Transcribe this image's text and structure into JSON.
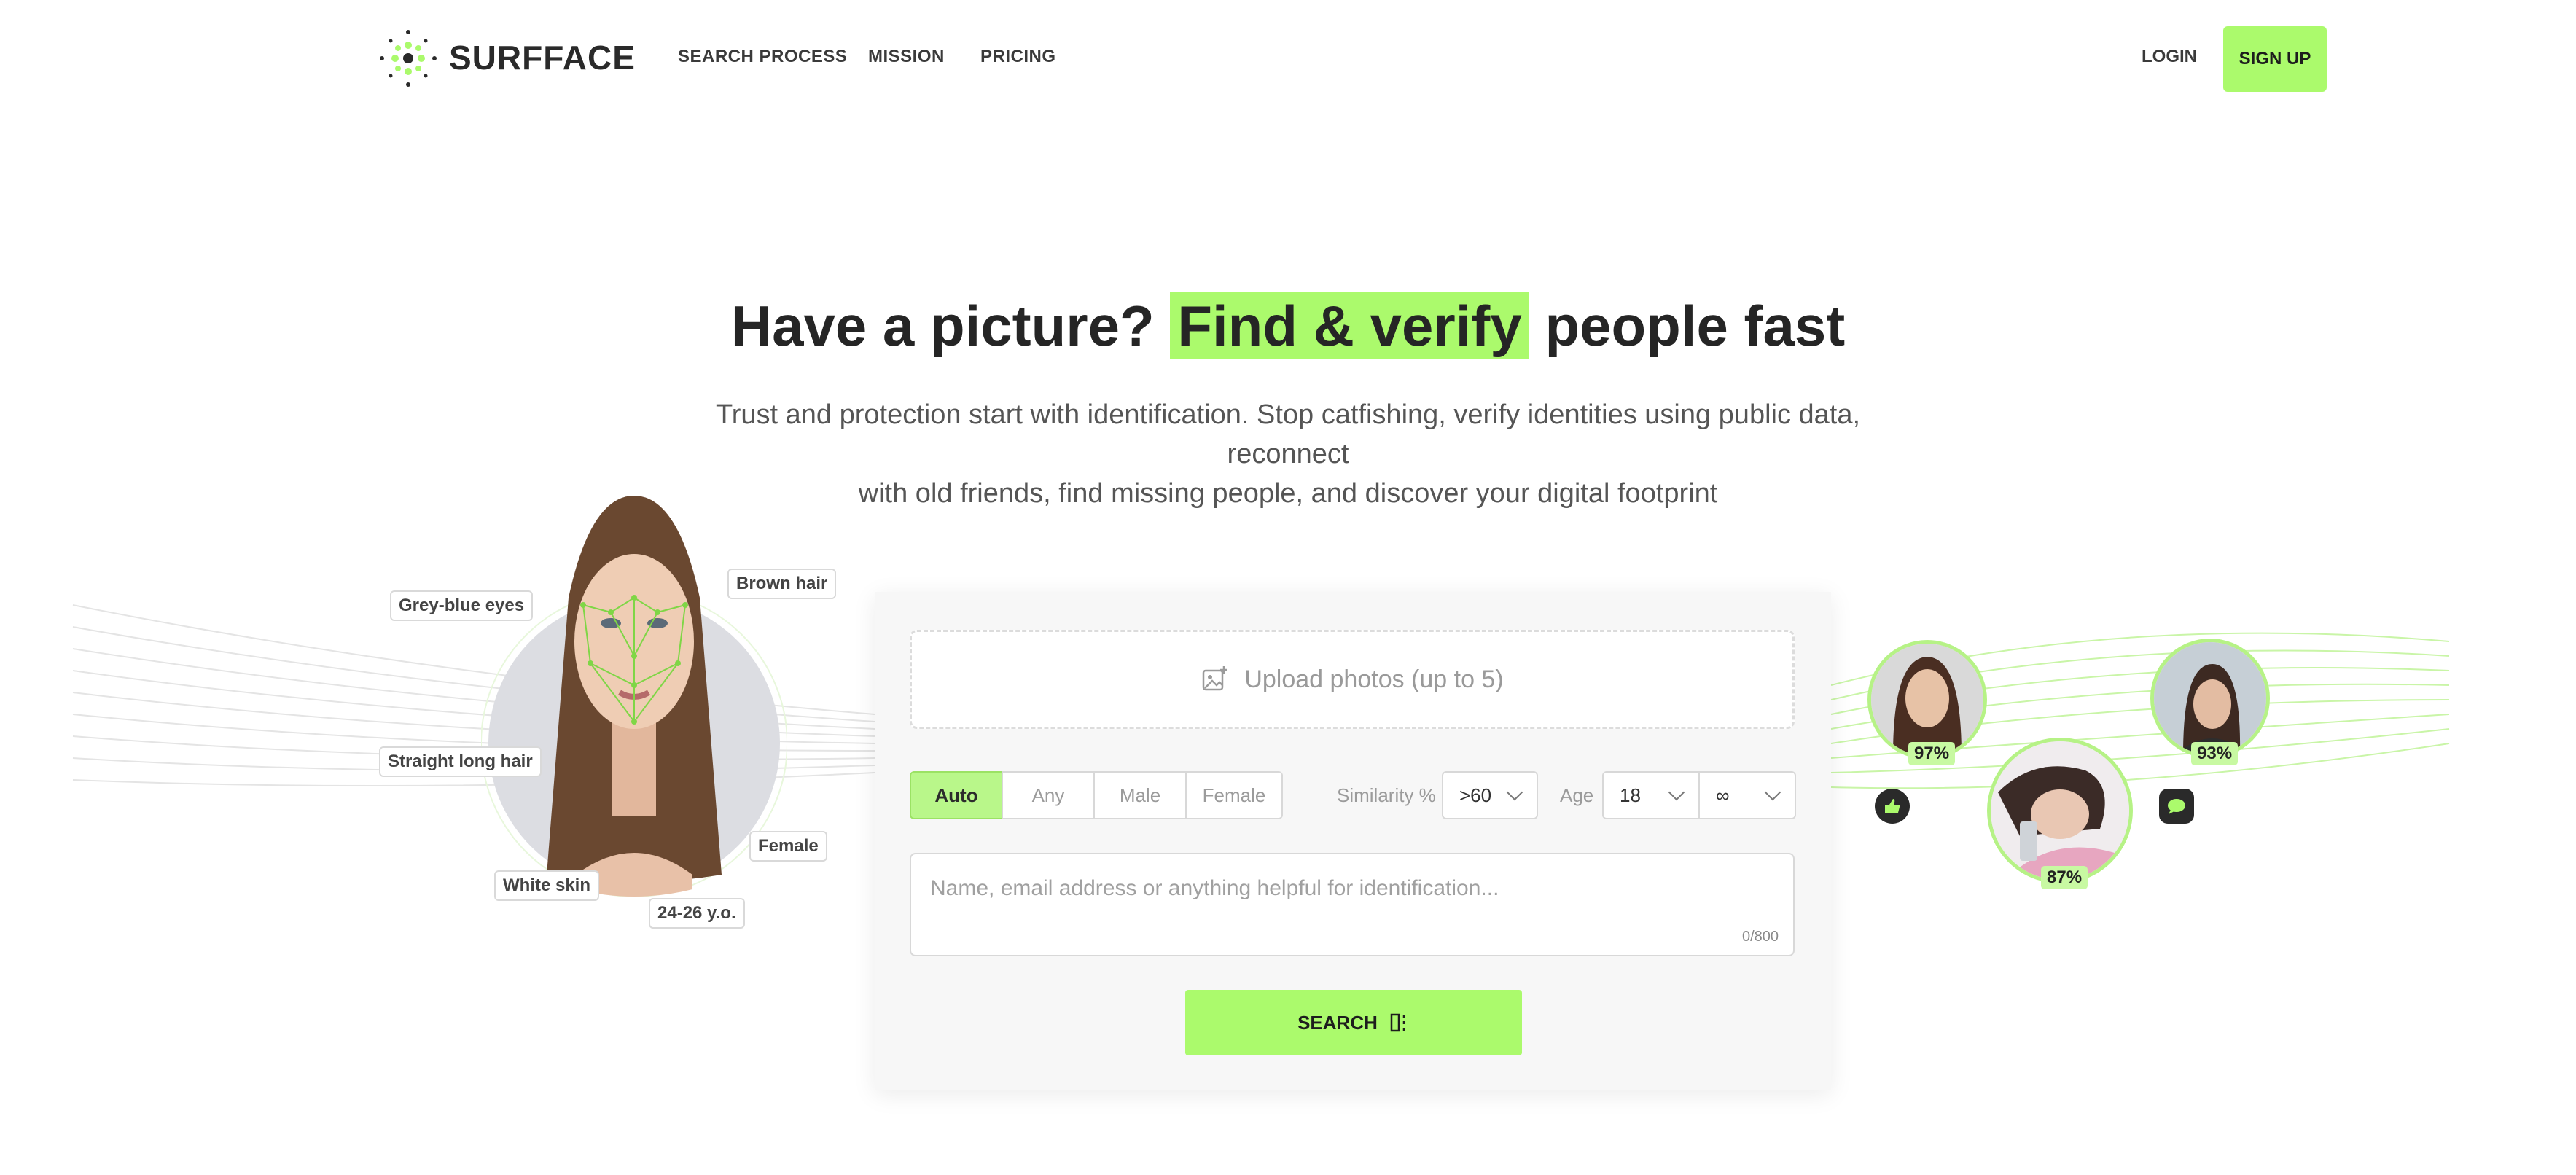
{
  "brand": {
    "name": "SURFFACE",
    "accent": "#abfa6c"
  },
  "nav": {
    "items": [
      {
        "label": "SEARCH PROCESS"
      },
      {
        "label": "MISSION"
      },
      {
        "label": "PRICING"
      }
    ],
    "login": "LOGIN",
    "signup": "SIGN UP"
  },
  "hero": {
    "title_pre": "Have a picture?",
    "title_highlight": "Find & verify",
    "title_post": "people fast",
    "subtitle_line1": "Trust and protection start with identification. Stop catfishing, verify identities using public data, reconnect",
    "subtitle_line2": "with old friends, find missing people, and discover your digital footprint"
  },
  "face_tags": {
    "eyes": "Grey-blue eyes",
    "hair_color": "Brown hair",
    "hair_style": "Straight long hair",
    "gender": "Female",
    "skin": "White skin",
    "age": "24-26 y.o."
  },
  "form": {
    "upload_label": "Upload photos (up to 5)",
    "gender_options": [
      "Auto",
      "Any",
      "Male",
      "Female"
    ],
    "gender_selected": "Auto",
    "similarity_label": "Similarity %",
    "similarity_value": ">60",
    "age_label": "Age",
    "age_min": "18",
    "age_max": "∞",
    "textarea_placeholder": "Name, email address or anything helpful for identification...",
    "counter": "0/800",
    "search_label": "SEARCH"
  },
  "results": [
    {
      "match": "97%"
    },
    {
      "match": "87%"
    },
    {
      "match": "93%"
    }
  ],
  "icons": {
    "logo": "dot-grid-logo-icon",
    "upload": "image-plus-icon",
    "search": "scan-icon",
    "like": "thumbs-up-icon",
    "chat": "chat-bubble-icon"
  }
}
